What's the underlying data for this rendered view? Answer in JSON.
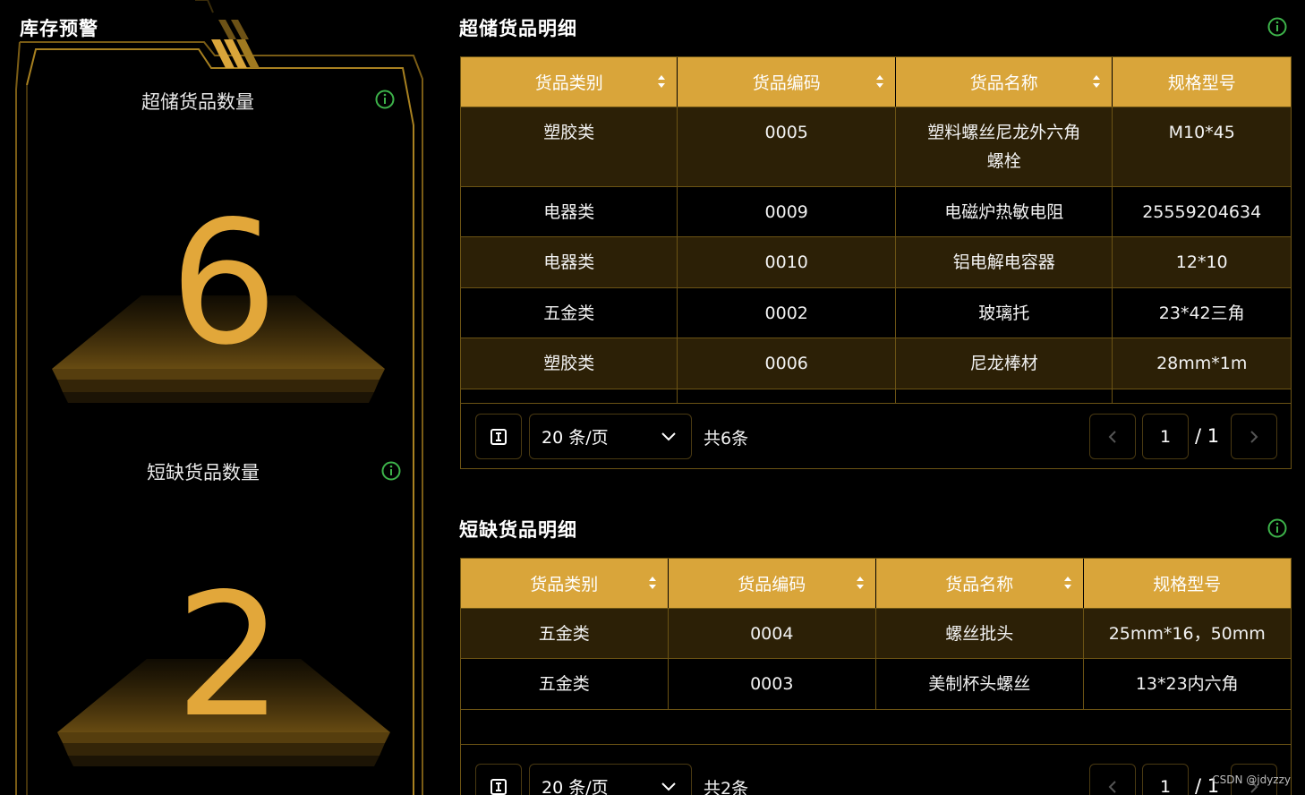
{
  "left": {
    "title": "库存预警",
    "over": {
      "label": "超储货品数量",
      "value": "6"
    },
    "short": {
      "label": "短缺货品数量",
      "value": "2"
    }
  },
  "overstock": {
    "title": "超储货品明细",
    "headers": [
      "货品类别",
      "货品编码",
      "货品名称",
      "规格型号"
    ],
    "rows": [
      [
        "塑胶类",
        "0005",
        "塑料螺丝尼龙外六角\n螺栓",
        "M10*45"
      ],
      [
        "电器类",
        "0009",
        "电磁炉热敏电阻",
        "25559204634"
      ],
      [
        "电器类",
        "0010",
        "铝电解电容器",
        "12*10"
      ],
      [
        "五金类",
        "0002",
        "玻璃托",
        "23*42三角"
      ],
      [
        "塑胶类",
        "0006",
        "尼龙棒材",
        "28mm*1m"
      ]
    ],
    "pager": {
      "page_size": "20 条/页",
      "total": "共6条",
      "current": "1",
      "pages": "/ 1"
    }
  },
  "shortage": {
    "title": "短缺货品明细",
    "headers": [
      "货品类别",
      "货品编码",
      "货品名称",
      "规格型号"
    ],
    "rows": [
      [
        "五金类",
        "0004",
        "螺丝批头",
        "25mm*16，50mm"
      ],
      [
        "五金类",
        "0003",
        "美制杯头螺丝",
        "13*23内六角"
      ]
    ],
    "pager": {
      "page_size": "20 条/页",
      "total": "共2条",
      "current": "1",
      "pages": "/ 1"
    }
  },
  "watermark": "CSDN @jdyzzy",
  "colors": {
    "accent": "#d9a53a",
    "number": "#e2a73a",
    "row_odd": "#2c2006",
    "info_icon": "#3db34a"
  }
}
